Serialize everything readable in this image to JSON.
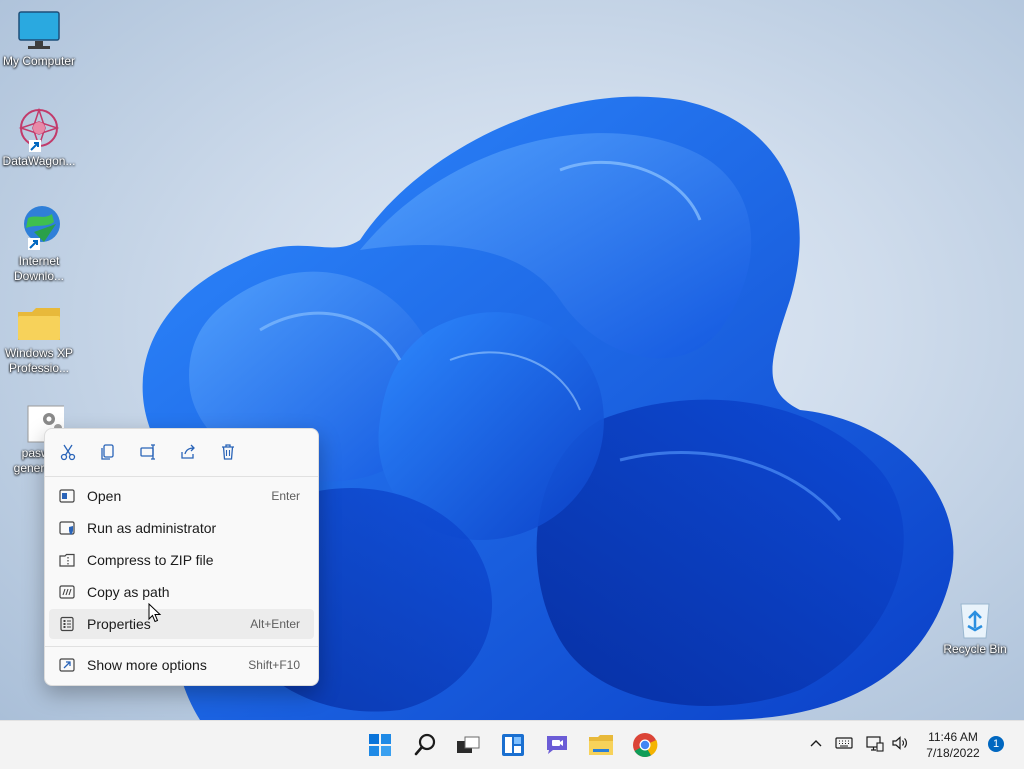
{
  "desktop_icons": [
    {
      "label": "My Computer",
      "icon": "monitor-icon"
    },
    {
      "label": "DataWagon...",
      "icon": "datawagon-icon"
    },
    {
      "label": "Internet Downlo...",
      "line1": "Internet",
      "line2": "Downlo...",
      "icon": "internet-download-manager-icon"
    },
    {
      "label": "Windows XP Professio...",
      "line1": "Windows XP",
      "line2": "Professio...",
      "icon": "folder-icon"
    },
    {
      "label": "paswo generat...",
      "line1": "paswo",
      "line2": "generat...",
      "icon": "app-settings-icon"
    },
    {
      "label": "Recycle Bin",
      "icon": "recycle-bin-icon"
    }
  ],
  "context_menu": {
    "toolbar": [
      {
        "name": "Cut",
        "icon": "scissors-icon"
      },
      {
        "name": "Copy",
        "icon": "copy-icon"
      },
      {
        "name": "Rename",
        "icon": "rename-icon"
      },
      {
        "name": "Share",
        "icon": "share-icon"
      },
      {
        "name": "Delete",
        "icon": "trash-icon"
      }
    ],
    "items": [
      {
        "label": "Open",
        "shortcut": "Enter",
        "icon": "open-window-icon"
      },
      {
        "label": "Run as administrator",
        "shortcut": "",
        "icon": "shield-icon"
      },
      {
        "label": "Compress to ZIP file",
        "shortcut": "",
        "icon": "zip-folder-icon"
      },
      {
        "label": "Copy as path",
        "shortcut": "",
        "icon": "path-icon"
      },
      {
        "label": "Properties",
        "shortcut": "Alt+Enter",
        "icon": "properties-icon",
        "highlighted": true
      },
      {
        "label": "Show more options",
        "shortcut": "Shift+F10",
        "icon": "more-options-icon"
      }
    ]
  },
  "taskbar": {
    "apps": [
      "start-icon",
      "search-icon",
      "task-view-icon",
      "widgets-icon",
      "chat-icon",
      "file-explorer-icon",
      "chrome-icon"
    ],
    "tray": [
      "chevron-up-icon",
      "keyboard-icon",
      "network-icon",
      "volume-icon"
    ],
    "time": "11:46 AM",
    "date": "7/18/2022",
    "notification_count": "1"
  },
  "colors": {
    "accent": "#0067c0",
    "bloom": "#1a6cf0",
    "menu_bg": "#f9f9f9",
    "taskbar_bg": "#f3f3f3"
  }
}
